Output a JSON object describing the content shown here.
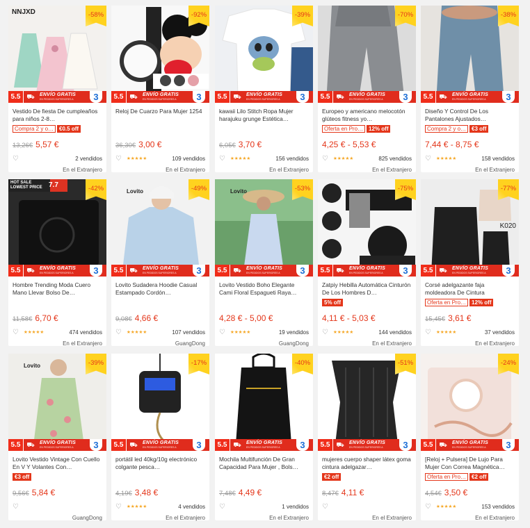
{
  "shipping_banner": {
    "tag": "5.5",
    "title": "ENVÍO GRATIS",
    "subtitle": "EN PEDIDOS SUPERIORES A",
    "num": "3"
  },
  "products": [
    {
      "discount": "-58%",
      "title": "Vestido De fiesta De cumpleaños para niños 2-8…",
      "promo_outline": "Compra 2 y o…",
      "promo_fill": "€0.5 off",
      "old_price": "13,26€",
      "price": "5,57 €",
      "stars": 0,
      "sold": "2 vendidos",
      "location": "En el Extranjero",
      "brand": "NNJXD"
    },
    {
      "discount": "-92%",
      "title": "Reloj De Cuarzo Para Mujer 1254",
      "promo_outline": "",
      "promo_fill": "",
      "old_price": "36,30€",
      "price": "3,00 €",
      "stars": 5,
      "sold": "109 vendidos",
      "location": "En el Extranjero",
      "brand": ""
    },
    {
      "discount": "-39%",
      "title": "kawaii Lilo Stitch Ropa Mujer harajuku grunge Estética…",
      "promo_outline": "",
      "promo_fill": "",
      "old_price": "6,05€",
      "price": "3,70 €",
      "stars": 5,
      "sold": "156 vendidos",
      "location": "En el Extranjero",
      "brand": ""
    },
    {
      "discount": "-70%",
      "title": "Europeo y americano melocotón glúteos fitness yo…",
      "promo_outline": "Oferta en Pro…",
      "promo_fill": "12% off",
      "old_price": "",
      "price": "4,25 € - 5,53 €",
      "stars": 5,
      "sold": "825 vendidos",
      "location": "En el Extranjero",
      "brand": ""
    },
    {
      "discount": "-38%",
      "title": "Diseño Y Control De Los Pantalones Ajustados…",
      "promo_outline": "Compra 2 y o…",
      "promo_fill": "€3 off",
      "old_price": "",
      "price": "7,44 € - 8,75 €",
      "stars": 5,
      "sold": "158 vendidos",
      "location": "En el Extranjero",
      "brand": ""
    },
    {
      "discount": "-42%",
      "title": "Hombre Trending Moda Cuero Mano Llevar Bolso De…",
      "promo_outline": "",
      "promo_fill": "",
      "old_price": "11,58€",
      "price": "6,70 €",
      "stars": 5,
      "sold": "474 vendidos",
      "location": "En el Extranjero",
      "brand": "",
      "hot_sale": "HOT SALE",
      "lowest": "LOWEST PRICE",
      "hot_num": "7.7"
    },
    {
      "discount": "-49%",
      "title": "Lovito Sudadera Hoodie Casual Estampado Cordón…",
      "promo_outline": "",
      "promo_fill": "",
      "old_price": "9,08€",
      "price": "4,66 €",
      "stars": 5,
      "sold": "107 vendidos",
      "location": "GuangDong",
      "brand": "Lovito"
    },
    {
      "discount": "-53%",
      "title": "Lovito Vestido Boho Elegante Cami Floral Espagueti Raya…",
      "promo_outline": "",
      "promo_fill": "",
      "old_price": "",
      "price": "4,28 € - 5,00 €",
      "stars": 5,
      "sold": "19 vendidos",
      "location": "GuangDong",
      "brand": "Lovito"
    },
    {
      "discount": "-75%",
      "title": "Zatpiy Hebilla Automática Cinturón De Los Hombres D…",
      "promo_outline": "",
      "promo_fill": "5% off",
      "old_price": "",
      "price": "4,11 € - 5,03 €",
      "stars": 5,
      "sold": "144 vendidos",
      "location": "En el Extranjero",
      "brand": ""
    },
    {
      "discount": "-77%",
      "title": "Corsé adelgazante faja moldeadora De Cintura",
      "promo_outline": "Oferta en Pro…",
      "promo_fill": "12% off",
      "old_price": "15,45€",
      "price": "3,61 €",
      "stars": 5,
      "sold": "37 vendidos",
      "location": "En el Extranjero",
      "brand": "",
      "sku": "K020"
    },
    {
      "discount": "-39%",
      "title": "Lovito Vestido Vintage Con Cuello En V Y Volantes Con…",
      "promo_outline": "",
      "promo_fill": "€3 off",
      "old_price": "9,56€",
      "price": "5,84 €",
      "stars": 0,
      "sold": "",
      "location": "GuangDong",
      "brand": "Lovito"
    },
    {
      "discount": "-17%",
      "title": "portátil led 40kg/10g electrónico colgante pesca…",
      "promo_outline": "",
      "promo_fill": "",
      "old_price": "4,19€",
      "price": "3,48 €",
      "stars": 5,
      "sold": "4 vendidos",
      "location": "En el Extranjero",
      "brand": ""
    },
    {
      "discount": "-40%",
      "title": "Mochila Multifunción De Gran Capacidad Para Mujer , Bols…",
      "promo_outline": "",
      "promo_fill": "",
      "old_price": "7,48€",
      "price": "4,49 €",
      "stars": 0,
      "sold": "1 vendidos",
      "location": "En el Extranjero",
      "brand": ""
    },
    {
      "discount": "-51%",
      "title": "mujeres cuerpo shaper látex goma cintura adelgazar…",
      "promo_outline": "",
      "promo_fill": "€2 off",
      "old_price": "8,47€",
      "price": "4,11 €",
      "stars": 0,
      "sold": "",
      "location": "En el Extranjero",
      "brand": ""
    },
    {
      "discount": "-24%",
      "title": "[Reloj + Pulsera] De Lujo Para Mujer Con Correa Magnética…",
      "promo_outline": "Oferta en Pro…",
      "promo_fill": "€2 off",
      "old_price": "4,54€",
      "price": "3,50 €",
      "stars": 5,
      "sold": "153 vendidos",
      "location": "En el Extranjero",
      "brand": ""
    }
  ],
  "star_glyph": "★",
  "heart_icon": "heart-outline-icon"
}
